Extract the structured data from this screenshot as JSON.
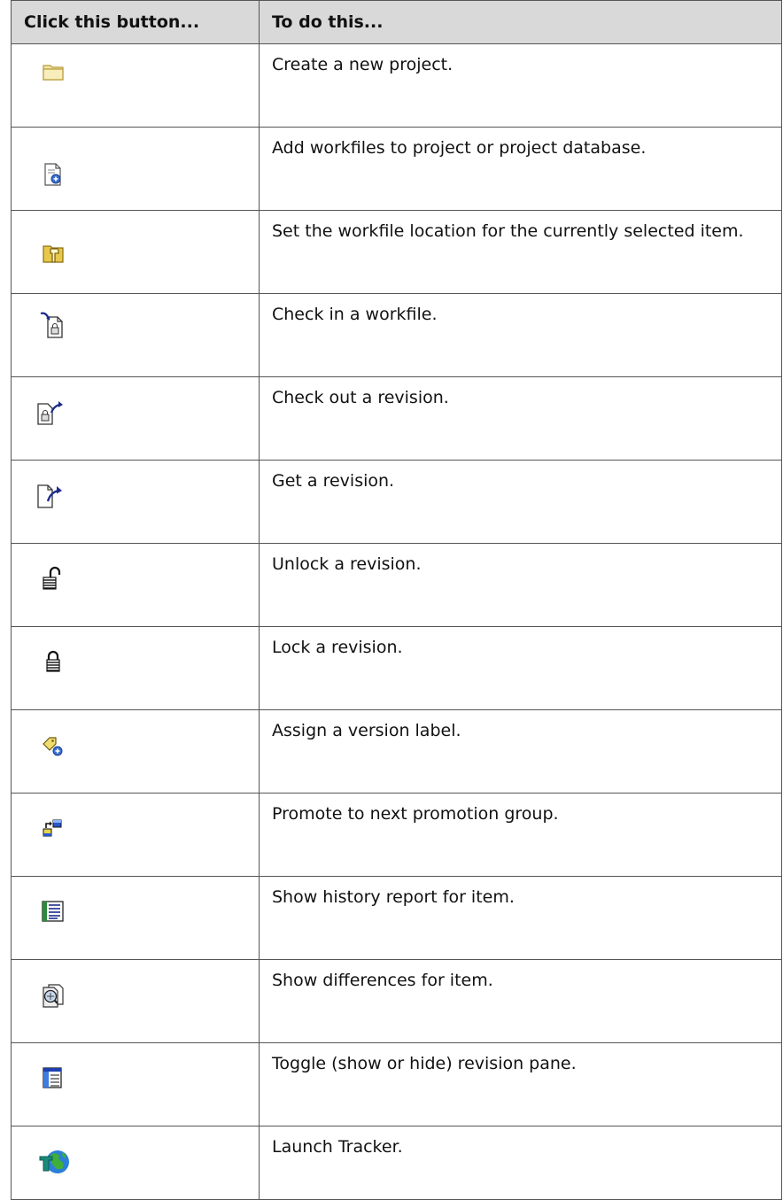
{
  "table": {
    "headers": [
      "Click this button...",
      "To do this..."
    ],
    "rows": [
      {
        "icon": "new-project-folder-icon",
        "description": "Create a new project."
      },
      {
        "icon": "add-workfiles-icon",
        "description": "Add workfiles to project or project database."
      },
      {
        "icon": "set-workfile-location-icon",
        "description": "Set the workfile location for the currently selected item."
      },
      {
        "icon": "check-in-icon",
        "description": "Check in a workfile."
      },
      {
        "icon": "check-out-icon",
        "description": "Check out a revision."
      },
      {
        "icon": "get-revision-icon",
        "description": "Get a revision."
      },
      {
        "icon": "unlock-icon",
        "description": "Unlock a revision."
      },
      {
        "icon": "lock-icon",
        "description": "Lock a revision."
      },
      {
        "icon": "version-label-icon",
        "description": "Assign a version label."
      },
      {
        "icon": "promote-icon",
        "description": "Promote to next promotion group."
      },
      {
        "icon": "history-report-icon",
        "description": "Show history report for item."
      },
      {
        "icon": "differences-icon",
        "description": "Show differences for item."
      },
      {
        "icon": "revision-pane-icon",
        "description": "Toggle (show or hide) revision pane."
      },
      {
        "icon": "tracker-globe-icon",
        "description": "Launch Tracker."
      }
    ]
  }
}
